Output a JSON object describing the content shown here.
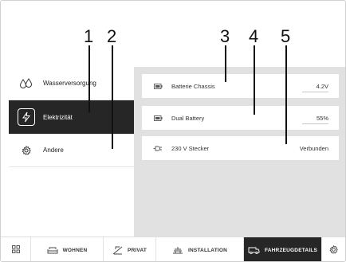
{
  "sidebar": {
    "items": [
      {
        "label": "Wasserversorgung",
        "icon": "water-drops-icon",
        "active": false
      },
      {
        "label": "Elektrizität",
        "icon": "lightning-icon",
        "active": true
      },
      {
        "label": "Andere",
        "icon": "gear-icon",
        "active": false
      }
    ]
  },
  "main": {
    "rows": [
      {
        "label": "Batterie Chassis",
        "value": "4.2V",
        "icon": "battery-icon"
      },
      {
        "label": "Dual Battery",
        "value": "55%",
        "icon": "battery-icon"
      },
      {
        "label": "230 V Stecker",
        "value": "Verbunden",
        "icon": "plug-icon"
      }
    ]
  },
  "callouts": [
    "1",
    "2",
    "3",
    "4",
    "5"
  ],
  "bottom_nav": {
    "items": [
      {
        "label": "",
        "icon": "grid-icon"
      },
      {
        "label": "WOHNEN",
        "icon": "sofa-icon"
      },
      {
        "label": "PRIVAT",
        "icon": "privacy-icon"
      },
      {
        "label": "INSTALLATION",
        "icon": "installation-icon"
      },
      {
        "label": "FAHRZEUGDETAILS",
        "icon": "vehicle-icon",
        "active": true
      },
      {
        "label": "",
        "icon": "settings-icon"
      }
    ]
  },
  "colors": {
    "active_bg": "#262626",
    "main_bg": "#e1e1e1",
    "callout": "#111111"
  }
}
